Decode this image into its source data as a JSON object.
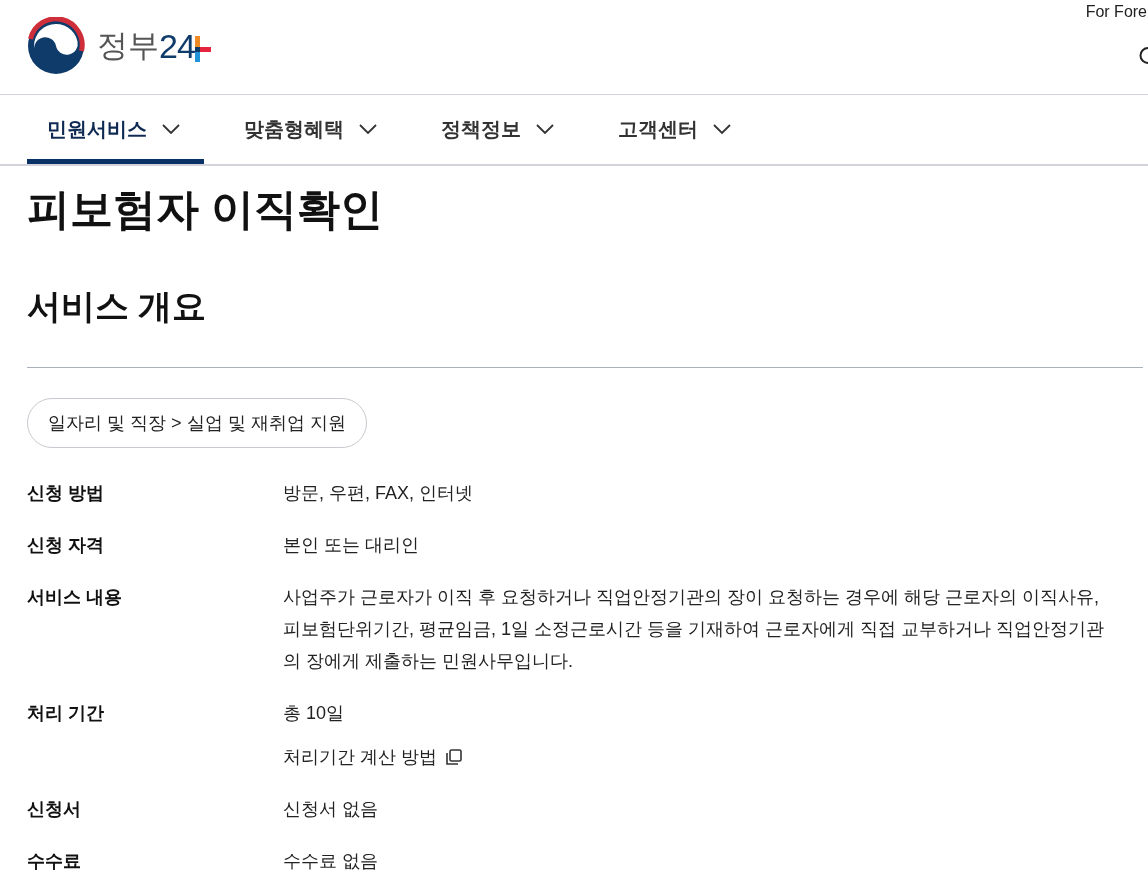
{
  "header": {
    "logo": {
      "name": "정부",
      "number": "24"
    },
    "language_link": "For Fore"
  },
  "nav": {
    "tabs": [
      {
        "label": "민원서비스",
        "selected": true
      },
      {
        "label": "맞춤형혜택",
        "selected": false
      },
      {
        "label": "정책정보",
        "selected": false
      },
      {
        "label": "고객센터",
        "selected": false
      }
    ]
  },
  "page_title": "피보험자 이직확인",
  "section_title": "서비스 개요",
  "category_path": "일자리 및 직장 > 실업 및 재취업 지원",
  "details": [
    {
      "label": "신청 방법",
      "values": [
        {
          "kind": "text",
          "text": "방문, 우편, FAX, 인터넷"
        }
      ]
    },
    {
      "label": "신청 자격",
      "values": [
        {
          "kind": "text",
          "text": "본인 또는 대리인"
        }
      ]
    },
    {
      "label": "서비스 내용",
      "values": [
        {
          "kind": "text",
          "text": "사업주가 근로자가 이직 후 요청하거나 직업안정기관의 장이 요청하는 경우에 해당 근로자의 이직사유, 피보험단위기간, 평균임금, 1일 소정근로시간 등을 기재하여 근로자에게 직접 교부하거나 직업안정기관의 장에게 제출하는 민원사무입니다."
        }
      ]
    },
    {
      "label": "처리 기간",
      "values": [
        {
          "kind": "text",
          "text": "총 10일"
        },
        {
          "kind": "link",
          "text": "처리기간 계산 방법"
        }
      ]
    },
    {
      "label": "신청서",
      "values": [
        {
          "kind": "text",
          "text": "신청서 없음"
        }
      ]
    },
    {
      "label": "수수료",
      "values": [
        {
          "kind": "text",
          "text": "수수료 없음"
        }
      ]
    }
  ]
}
